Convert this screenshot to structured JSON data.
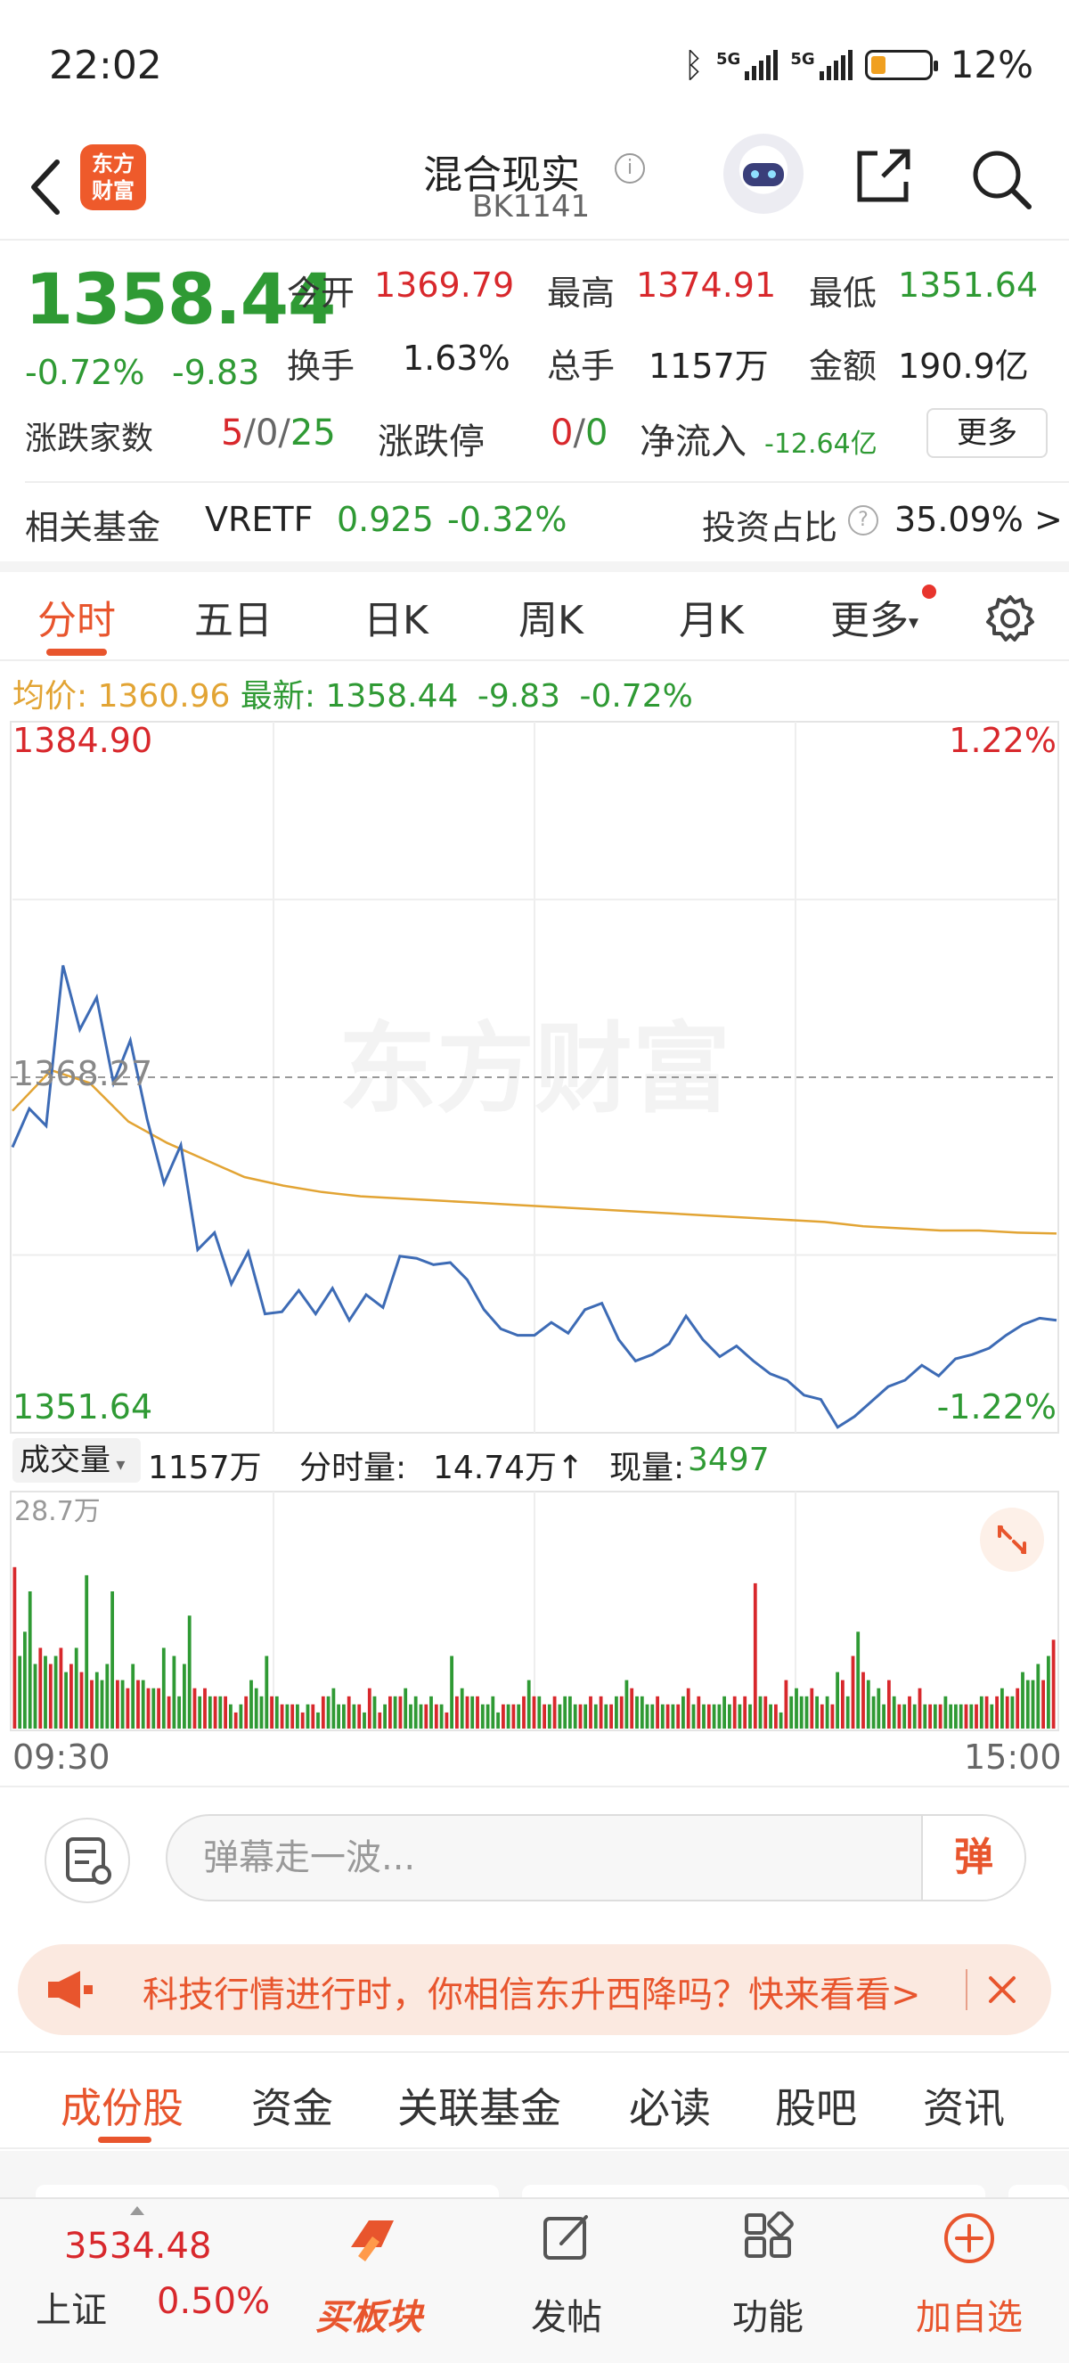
{
  "status_bar": {
    "time": "22:02",
    "net1": "5G",
    "net2": "5G",
    "battery": "12%"
  },
  "header": {
    "logo_text": "东方财富",
    "title": "混合现实",
    "code": "BK1141"
  },
  "quote": {
    "price": "1358.44",
    "pct": "-0.72%",
    "chg": "-9.83",
    "open_label": "今开",
    "open": "1369.79",
    "high_label": "最高",
    "high": "1374.91",
    "low_label": "最低",
    "low": "1351.64",
    "turnover_label": "换手",
    "turnover": "1.63%",
    "volume_label": "总手",
    "volume": "1157万",
    "amount_label": "金额",
    "amount": "190.9亿",
    "breadth_label": "涨跌家数",
    "up": "5",
    "flat": "0",
    "down": "25",
    "limit_label": "涨跌停",
    "limit_up": "0",
    "limit_down": "0",
    "inflow_label": "净流入",
    "inflow": "-12.64亿",
    "more": "更多"
  },
  "fund": {
    "label": "相关基金",
    "name": "VRETF",
    "price": "0.925",
    "pct": "-0.32%",
    "ratio_label": "投资占比",
    "ratio": "35.09% >"
  },
  "chart_tabs": [
    "分时",
    "五日",
    "日K",
    "周K",
    "月K",
    "更多"
  ],
  "legend": {
    "avg_label": "均价:",
    "avg": "1360.96",
    "last_label": "最新:",
    "last": "1358.44",
    "chg": "-9.83",
    "pct": "-0.72%"
  },
  "axis": {
    "top": "1384.90",
    "mid": "1368.27",
    "bottom": "1351.64",
    "top_pct": "1.22%",
    "bottom_pct": "-1.22%"
  },
  "volume": {
    "select": "成交量",
    "total": "1157万",
    "minute_label": "分时量:",
    "minute": "14.74万",
    "arrow": "↑",
    "now_label": "现量:",
    "now": "3497",
    "max": "28.7万"
  },
  "times": {
    "start": "09:30",
    "end": "15:00"
  },
  "watermark": "东方财富",
  "danmaku": {
    "placeholder": "弹幕走一波...",
    "button": "弹"
  },
  "banner": {
    "text": "科技行情进行时，你相信东升西降吗？快来看看>"
  },
  "bottom_tabs": [
    "成份股",
    "资金",
    "关联基金",
    "必读",
    "股吧",
    "资讯"
  ],
  "navbar": {
    "index_value": "3534.48",
    "index_name": "上证",
    "index_pct": "0.50%",
    "buy": "买板块",
    "post": "发帖",
    "func": "功能",
    "watch": "加自选"
  },
  "colors": {
    "up": "#d8282c",
    "down": "#2f9a34",
    "accent": "#e8552d",
    "avg_line": "#e2a434",
    "price_line": "#3d6bb5"
  },
  "chart_data": {
    "type": "line",
    "title": "",
    "x": [
      "09:30",
      "15:00"
    ],
    "ylim": [
      1351.64,
      1384.9
    ],
    "prev_close": 1368.27,
    "series": [
      {
        "name": "最新",
        "values": [
          1365.0,
          1366.8,
          1366.0,
          1373.5,
          1370.5,
          1372.0,
          1368.0,
          1370.0,
          1366.3,
          1363.3,
          1365.1,
          1360.2,
          1361.0,
          1358.6,
          1360.1,
          1357.2,
          1357.3,
          1358.3,
          1357.2,
          1358.4,
          1356.9,
          1358.1,
          1357.5,
          1359.9,
          1359.8,
          1359.5,
          1359.6,
          1358.8,
          1357.4,
          1356.5,
          1356.2,
          1356.2,
          1356.8,
          1356.3,
          1357.4,
          1357.7,
          1356.0,
          1355.0,
          1355.3,
          1355.8,
          1357.1,
          1356.0,
          1355.2,
          1355.7,
          1355.0,
          1354.4,
          1354.1,
          1353.4,
          1353.2,
          1351.9,
          1352.4,
          1353.1,
          1353.8,
          1354.1,
          1354.8,
          1354.3,
          1355.1,
          1355.3,
          1355.6,
          1356.2,
          1356.7,
          1357.0,
          1356.9
        ]
      },
      {
        "name": "均价",
        "values": [
          1366.7,
          1368.6,
          1368.0,
          1366.2,
          1365.2,
          1364.4,
          1363.6,
          1363.2,
          1362.9,
          1362.7,
          1362.6,
          1362.5,
          1362.4,
          1362.3,
          1362.2,
          1362.1,
          1362.0,
          1361.9,
          1361.8,
          1361.7,
          1361.6,
          1361.5,
          1361.3,
          1361.2,
          1361.1,
          1361.1,
          1361.0,
          1360.96
        ]
      }
    ]
  },
  "volume_data": {
    "max": 28.7,
    "bars": [
      20,
      9,
      12,
      17,
      8,
      10,
      9,
      8,
      9,
      10,
      7,
      8,
      10,
      7,
      19,
      6,
      7,
      6,
      8,
      17,
      6,
      6,
      5,
      8,
      6,
      6,
      5,
      5,
      5,
      10,
      4,
      9,
      4,
      8,
      14,
      5,
      4,
      5,
      4,
      4,
      4,
      4,
      3,
      2,
      3,
      4,
      6,
      5,
      4,
      9,
      4,
      4,
      3,
      3,
      3,
      3,
      2,
      3,
      3,
      2,
      4,
      4,
      5,
      3,
      3,
      4,
      3,
      3,
      2,
      5,
      4,
      2,
      3,
      4,
      4,
      4,
      5,
      3,
      4,
      3,
      3,
      4,
      3,
      3,
      2,
      9,
      4,
      5,
      4,
      4,
      4,
      3,
      3,
      4,
      2,
      3,
      3,
      3,
      3,
      4,
      6,
      4,
      4,
      3,
      3,
      4,
      3,
      4,
      4,
      3,
      3,
      3,
      4,
      3,
      4,
      3,
      3,
      4,
      4,
      6,
      5,
      4,
      4,
      3,
      3,
      4,
      3,
      3,
      3,
      3,
      4,
      5,
      3,
      4,
      3,
      3,
      3,
      3,
      4,
      3,
      4,
      3,
      4,
      3,
      18,
      4,
      4,
      3,
      3,
      2,
      6,
      4,
      5,
      4,
      4,
      5,
      4,
      3,
      4,
      3,
      7,
      6,
      4,
      9,
      12,
      7,
      6,
      4,
      5,
      3,
      6,
      4,
      3,
      3,
      4,
      3,
      5,
      3,
      3,
      3,
      3,
      4,
      3,
      3,
      3,
      3,
      3,
      3,
      4,
      4,
      3,
      4,
      5,
      4,
      4,
      5,
      7,
      6,
      6,
      8,
      6,
      9,
      11
    ]
  }
}
